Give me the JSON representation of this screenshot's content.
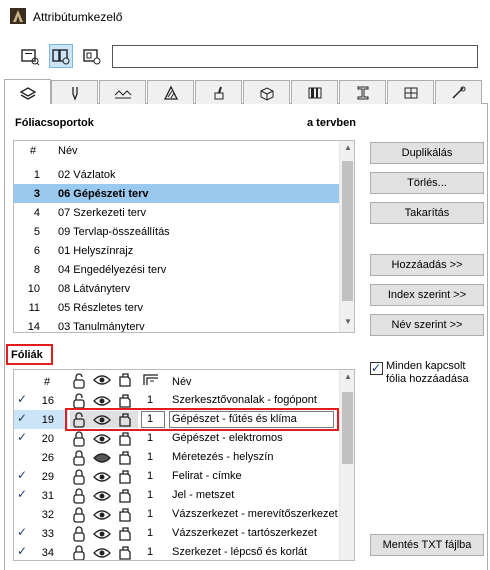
{
  "window": {
    "title": "Attribútumkezelő"
  },
  "search": {
    "value": ""
  },
  "group_section": {
    "label": "Fóliacsoportok",
    "right_label": "a tervben",
    "header_num": "#",
    "header_name": "Név",
    "rows": [
      {
        "num": "1",
        "name": "02 Vázlatok",
        "selected": false
      },
      {
        "num": "3",
        "name": "06 Gépészeti terv",
        "selected": true
      },
      {
        "num": "4",
        "name": "07 Szerkezeti terv",
        "selected": false
      },
      {
        "num": "5",
        "name": "09 Tervlap-összeállítás",
        "selected": false
      },
      {
        "num": "6",
        "name": "01 Helyszínrajz",
        "selected": false
      },
      {
        "num": "8",
        "name": "04 Engedélyezési terv",
        "selected": false
      },
      {
        "num": "10",
        "name": "08 Látványterv",
        "selected": false
      },
      {
        "num": "11",
        "name": "05 Részletes terv",
        "selected": false
      },
      {
        "num": "14",
        "name": "03 Tanulmányterv",
        "selected": false
      }
    ]
  },
  "buttons": {
    "duplicate": "Duplikálás",
    "delete": "Törlés...",
    "cleanup": "Takarítás",
    "add": "Hozzáadás >>",
    "by_index": "Index szerint >>",
    "by_name": "Név szerint >>",
    "save_txt": "Mentés TXT fájlba"
  },
  "layers_section": {
    "label": "Fóliák",
    "header_num": "#",
    "header_name": "Név",
    "rows": [
      {
        "check": "✓",
        "num": "16",
        "lock": "open",
        "vis": "eye",
        "pen": "1",
        "name": "Szerkesztővonalak - fogópont"
      },
      {
        "check": "✓",
        "num": "19",
        "lock": "open",
        "vis": "eye",
        "pen": "1",
        "name": "Gépészet - fűtés és klíma",
        "editing": true
      },
      {
        "check": "✓",
        "num": "20",
        "lock": "closed",
        "vis": "eye",
        "pen": "1",
        "name": "Gépészet - elektromos"
      },
      {
        "check": "",
        "num": "26",
        "lock": "closed",
        "vis": "hidden",
        "pen": "1",
        "name": "Méretezés - helyszín"
      },
      {
        "check": "✓",
        "num": "29",
        "lock": "closed",
        "vis": "eye",
        "pen": "1",
        "name": "Felirat - címke"
      },
      {
        "check": "✓",
        "num": "31",
        "lock": "closed",
        "vis": "eye",
        "pen": "1",
        "name": "Jel - metszet"
      },
      {
        "check": "",
        "num": "32",
        "lock": "closed",
        "vis": "eye",
        "pen": "1",
        "name": "Vázszerkezet - merevítőszerkezet"
      },
      {
        "check": "✓",
        "num": "33",
        "lock": "closed",
        "vis": "eye",
        "pen": "1",
        "name": "Vázszerkezet - tartószerkezet"
      },
      {
        "check": "✓",
        "num": "34",
        "lock": "closed",
        "vis": "eye",
        "pen": "1",
        "name": "Szerkezet - lépcső és korlát"
      }
    ]
  },
  "add_all": {
    "line1": "Minden kapcsolt",
    "line2": "fólia hozzáadása",
    "checked": true
  }
}
